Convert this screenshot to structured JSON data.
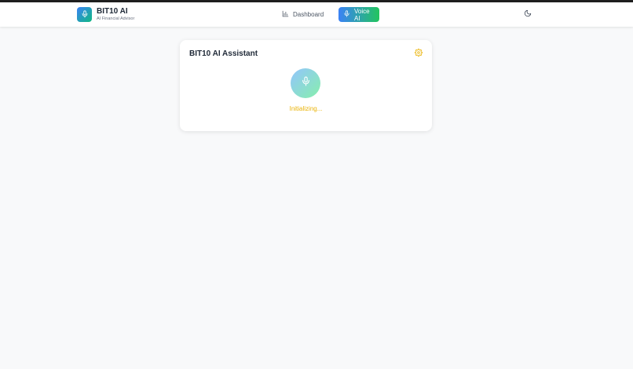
{
  "brand": {
    "title": "BIT10 AI",
    "subtitle": "AI Financial Advisor",
    "logo_icon": "microphone-icon"
  },
  "nav": {
    "items": [
      {
        "label": "Dashboard",
        "icon": "bar-chart-icon",
        "active": false
      },
      {
        "label": "Voice AI",
        "icon": "microphone-icon",
        "active": true
      }
    ],
    "theme_toggle_icon": "moon-icon"
  },
  "assistant": {
    "title": "BIT10 AI Assistant",
    "settings_icon": "gear-icon",
    "mic_icon": "microphone-icon",
    "status": "Initializing..."
  },
  "colors": {
    "accent_blue": "#3b82f6",
    "accent_green": "#22c55e",
    "status_yellow": "#eab308",
    "background": "#f8f9fa"
  }
}
